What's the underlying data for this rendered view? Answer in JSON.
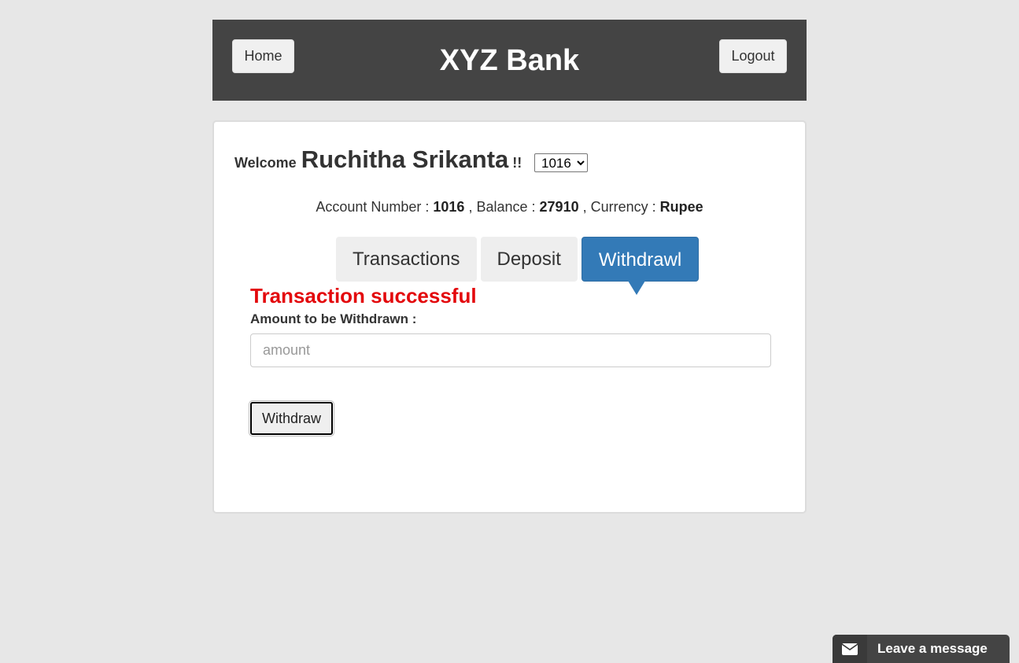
{
  "header": {
    "home_label": "Home",
    "title": "XYZ Bank",
    "logout_label": "Logout"
  },
  "welcome": {
    "greeting": "Welcome",
    "name": "Ruchitha Srikanta",
    "suffix": "!!",
    "selected_account": "1016"
  },
  "account_info": {
    "account_number_label": "Account Number :",
    "account_number": "1016",
    "balance_label": ", Balance :",
    "balance": "27910",
    "currency_label": ", Currency :",
    "currency": "Rupee"
  },
  "tabs": [
    {
      "label": "Transactions",
      "active": false
    },
    {
      "label": "Deposit",
      "active": false
    },
    {
      "label": "Withdrawl",
      "active": true
    }
  ],
  "withdraw_form": {
    "status_message": "Transaction successful",
    "amount_label": "Amount to be Withdrawn :",
    "amount_placeholder": "amount",
    "submit_label": "Withdraw"
  },
  "chat": {
    "icon": "envelope-icon",
    "label": "Leave a message"
  },
  "colors": {
    "header_bg": "#444444",
    "active_tab": "#337ab7",
    "success_message": "#e3080c",
    "page_bg": "#e7e7e7"
  }
}
